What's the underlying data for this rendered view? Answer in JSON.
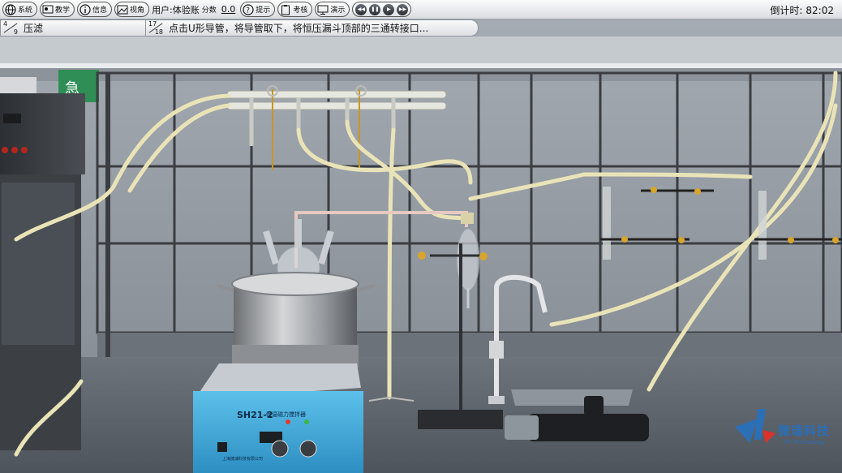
{
  "toolbar": {
    "system_label": "系统",
    "teach_label": "教学",
    "info_label": "信息",
    "view_label": "视角",
    "user_label": "用户:体验账",
    "score_label": "分数",
    "score_value": "0.0",
    "hint_label": "提示",
    "exam_label": "考核",
    "demo_label": "演示",
    "timer_label": "倒计时:",
    "timer_value": "82:02"
  },
  "steps": {
    "stage_num": "4",
    "stage_den": "9",
    "stage_title": "压滤",
    "step_num": "17",
    "step_den": "18",
    "step_text": "点击U形导管，将导管取下，将恒压漏斗顶部的三通转接口..."
  },
  "scene": {
    "sign_text": "急",
    "stirrer_model": "SH21-2",
    "stirrer_name": "恒温磁力搅拌器",
    "stirrer_maker": "上海捷浦科技有限公司"
  },
  "logo": {
    "name": "微瑞科技",
    "subtitle": "VR Technology"
  },
  "colors": {
    "toolbar_bg": "#e4e6ea",
    "stirrer_blue": "#3aa6d6",
    "tubing": "#e9e4b8",
    "logo_blue": "#2b6fb7",
    "logo_red": "#d9322b"
  }
}
